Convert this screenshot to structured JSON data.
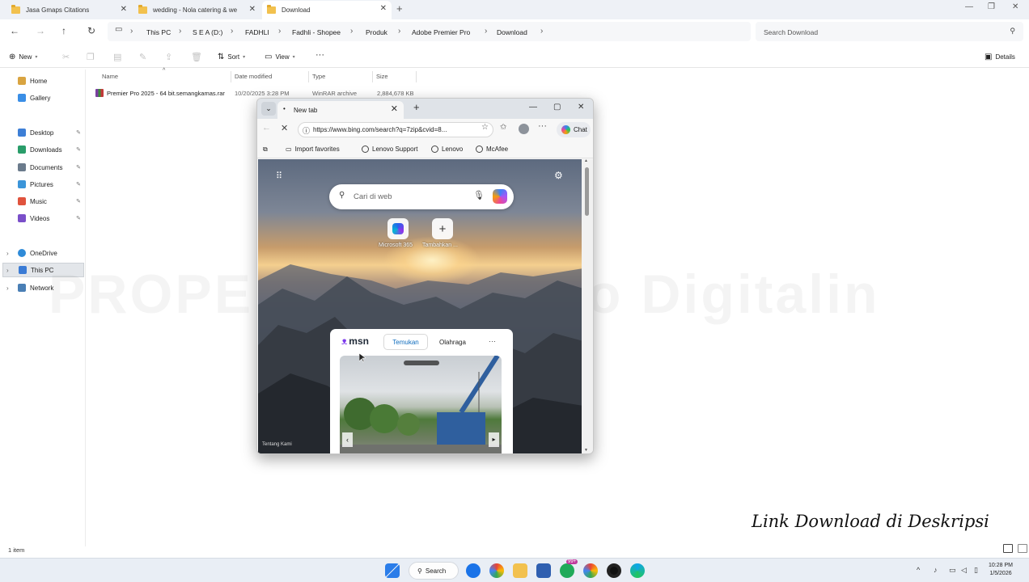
{
  "explorer": {
    "tabs": [
      {
        "label": "Jasa Gmaps Citations"
      },
      {
        "label": "wedding - Nola catering & we"
      },
      {
        "label": "Download"
      }
    ],
    "breadcrumb": [
      "This PC",
      "S E A (D:)",
      "FADHLI",
      "Fadhli - Shopee",
      "Produk",
      "Adobe Premier Pro",
      "Download"
    ],
    "search_placeholder": "Search Download",
    "commands": {
      "new": "New",
      "sort": "Sort",
      "view": "View",
      "more": "···",
      "details": "Details"
    },
    "sidebar": {
      "quick": [
        {
          "label": "Home",
          "color": "#d9a441"
        },
        {
          "label": "Gallery",
          "color": "#3a8ee6"
        }
      ],
      "pinned": [
        {
          "label": "Desktop",
          "color": "#3d7fd6"
        },
        {
          "label": "Downloads",
          "color": "#2a9d6a"
        },
        {
          "label": "Documents",
          "color": "#6b7b8c"
        },
        {
          "label": "Pictures",
          "color": "#3b95d9"
        },
        {
          "label": "Music",
          "color": "#e0533d"
        },
        {
          "label": "Videos",
          "color": "#7a4fc9"
        }
      ],
      "tree": [
        {
          "label": "OneDrive",
          "color": "#2f8bd8"
        },
        {
          "label": "This PC",
          "color": "#3a7bd5"
        },
        {
          "label": "Network",
          "color": "#4a7fb5"
        }
      ]
    },
    "columns": {
      "name": "Name",
      "date": "Date modified",
      "type": "Type",
      "size": "Size"
    },
    "file": {
      "name": "Premier Pro 2025 - 64 bit.semangkamas.rar",
      "date": "10/20/2025 3:28 PM",
      "type": "WinRAR archive",
      "size": "2,884,678 KB"
    },
    "status": "1 item"
  },
  "browser": {
    "tab_title": "New tab",
    "url": "https://www.bing.com/search?q=7zip&cvid=8...",
    "chat": "Chat",
    "favorites": [
      "Import favorites",
      "Lenovo Support",
      "Lenovo",
      "McAfee"
    ],
    "ntp": {
      "search_placeholder": "Cari di web",
      "tiles": [
        "Microsoft 365",
        "Tambahkan ..."
      ],
      "msn_logo": "msn",
      "msn_tabs": [
        "Temukan",
        "Olahraga",
        "···"
      ],
      "credit": "Tentang Kami"
    }
  },
  "overlay": {
    "watermark": "PROPERTY OF Toko Digitalin",
    "caption": "Link Download di Deskripsi"
  },
  "taskbar": {
    "search": "Search",
    "time": "10:28 PM",
    "date": "1/5/2026",
    "badge_count": "99+"
  }
}
